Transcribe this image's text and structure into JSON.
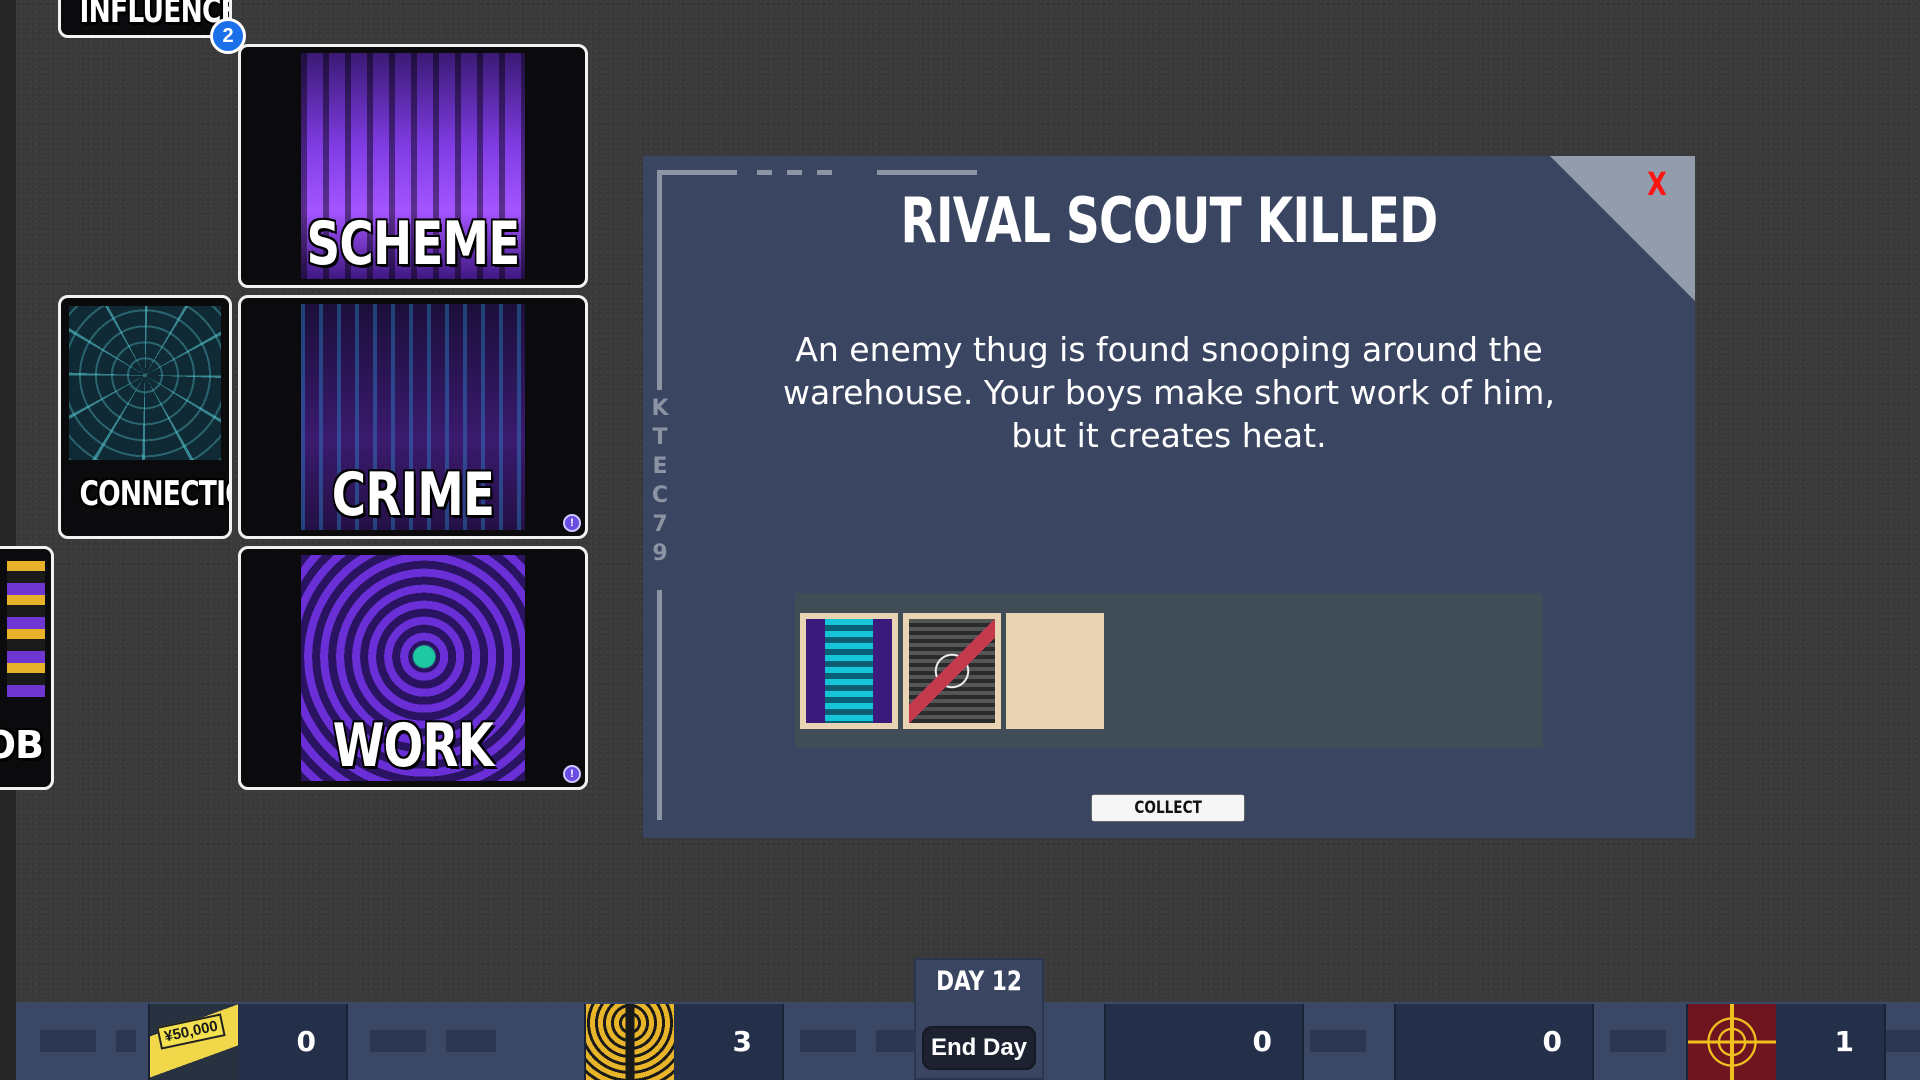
{
  "cards": {
    "influence": {
      "title": "INFLUENCE",
      "badge": "2"
    },
    "scheme": {
      "title": "SCHEME"
    },
    "crime": {
      "title": "CRIME",
      "alert": "!"
    },
    "work": {
      "title": "WORK",
      "alert": "!"
    },
    "connection": {
      "title": "CONNECTION"
    },
    "job": {
      "title": "OB"
    }
  },
  "modal": {
    "title": "RIVAL SCOUT KILLED",
    "code": "KTEC79",
    "close_label": "X",
    "body": "An enemy thug is found snooping around the warehouse. Your boys make short work of him, but it creates heat.",
    "rewards": [
      {
        "icon": "alley-card-icon"
      },
      {
        "icon": "no-target-card-icon"
      },
      {
        "icon": "heat-alarm-card-icon"
      }
    ],
    "collect_label": "COLLECT"
  },
  "bottom_bar": {
    "money": {
      "icon": "money-bill-icon",
      "bill_text": "¥50,000",
      "value": "0"
    },
    "influence": {
      "icon": "radio-tower-icon",
      "value": "3"
    },
    "day": {
      "label": "DAY 12",
      "end_day_label": "End Day"
    },
    "heat": {
      "icon": "heat-alarm-icon",
      "value": "0"
    },
    "crew": {
      "icon": "crew-silhouette-icon",
      "value": "0"
    },
    "target": {
      "icon": "crosshair-target-icon",
      "value": "1"
    }
  },
  "colors": {
    "modal_bg": "#394561",
    "close_red": "#ff1414",
    "card_border": "#f2f2f2",
    "badge_blue": "#1b6fe8"
  }
}
